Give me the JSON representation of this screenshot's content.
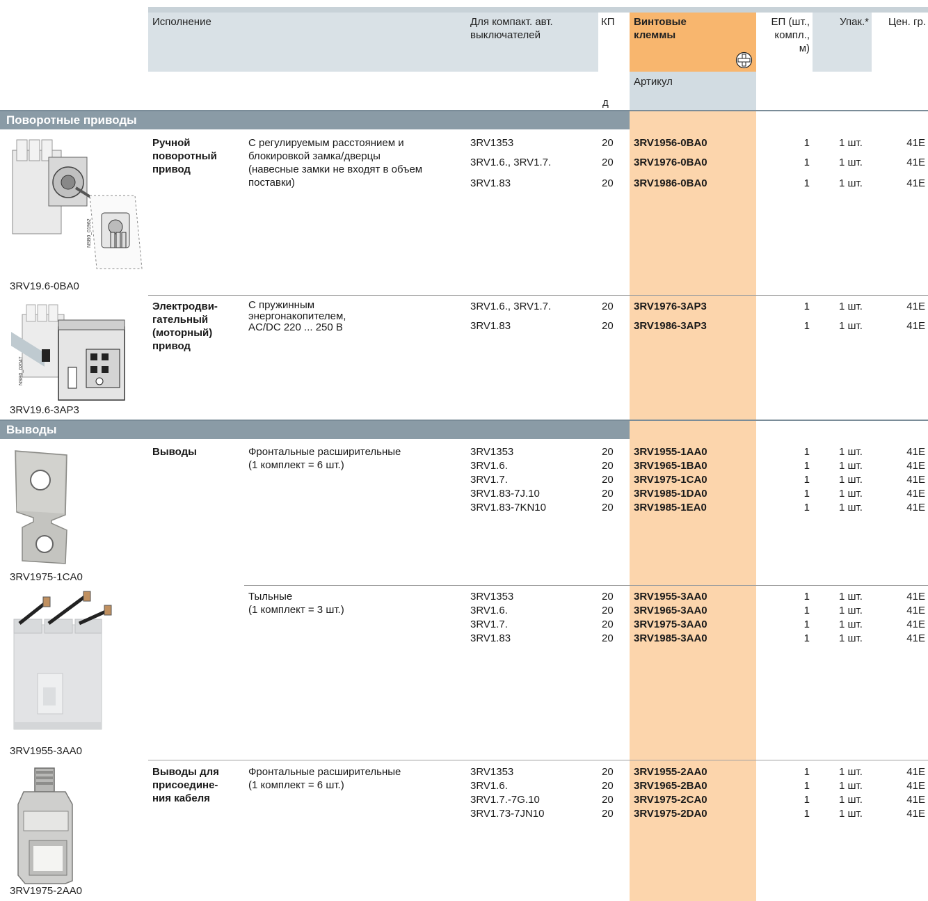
{
  "header": {
    "ispolnenie": "Исполнение",
    "compact_line1": "Для компакт. авт.",
    "compact_line2": "выключателей",
    "kp": "КП",
    "kp_unit": "д",
    "screw_line1": "Винтовые",
    "screw_line2": "клеммы",
    "artikul": "Артикул",
    "ep_line1": "ЕП (шт.,",
    "ep_line2": "компл.,",
    "ep_line3": "м)",
    "upak": "Упак.*",
    "price_group": "Цен. гр."
  },
  "colors": {
    "accent_orange": "#f8b66e",
    "light_orange": "#fcd5ac",
    "header_blue": "#d2dce2",
    "section_bar": "#8a9ba6"
  },
  "sections": [
    {
      "title": "Поворотные приводы",
      "groups": [
        {
          "image_caption": "3RV19.6-0BA0",
          "image_icon": "rotary-handle-drive-icon",
          "name_lines": [
            "Ручной",
            "поворотный",
            "привод"
          ],
          "desc_lines": [
            "С регулируемым расстоянием и",
            "блокировкой замка/дверцы",
            "(навесные замки не входят в объем",
            "поставки)"
          ],
          "rows": [
            {
              "breaker": "3RV1353",
              "kp": "20",
              "article": "3RV1956-0BA0",
              "ep": "1",
              "pack": "1 шт.",
              "price": "41E"
            },
            {
              "breaker": "3RV1.6., 3RV1.7.",
              "kp": "20",
              "article": "3RV1976-0BA0",
              "ep": "1",
              "pack": "1 шт.",
              "price": "41E"
            },
            {
              "breaker": "3RV1.83",
              "kp": "20",
              "article": "3RV1986-0BA0",
              "ep": "1",
              "pack": "1 шт.",
              "price": "41E"
            }
          ]
        },
        {
          "image_caption": "3RV19.6-3AP3",
          "image_icon": "motor-drive-icon",
          "name_lines": [
            "Электродви-",
            "гательный",
            "(моторный)",
            "привод"
          ],
          "desc_lines": [
            "С пружинным",
            "энергонакопителем,",
            "AC/DC 220 ... 250 В"
          ],
          "rows": [
            {
              "breaker": "3RV1.6., 3RV1.7.",
              "kp": "20",
              "article": "3RV1976-3AP3",
              "ep": "1",
              "pack": "1 шт.",
              "price": "41E"
            },
            {
              "breaker": "3RV1.83",
              "kp": "20",
              "article": "3RV1986-3AP3",
              "ep": "1",
              "pack": "1 шт.",
              "price": "41E"
            }
          ]
        }
      ]
    },
    {
      "title": "Выводы",
      "groups": [
        {
          "image_caption": "3RV1975-1CA0",
          "image_icon": "front-terminal-icon",
          "name_lines": [
            "Выводы"
          ],
          "desc_lines": [
            "Фронтальные расширительные",
            "(1 комплект = 6 шт.)"
          ],
          "rows": [
            {
              "breaker": "3RV1353",
              "kp": "20",
              "article": "3RV1955-1AA0",
              "ep": "1",
              "pack": "1 шт.",
              "price": "41E"
            },
            {
              "breaker": "3RV1.6.",
              "kp": "20",
              "article": "3RV1965-1BA0",
              "ep": "1",
              "pack": "1 шт.",
              "price": "41E"
            },
            {
              "breaker": "3RV1.7.",
              "kp": "20",
              "article": "3RV1975-1CA0",
              "ep": "1",
              "pack": "1 шт.",
              "price": "41E"
            },
            {
              "breaker": "3RV1.83-7J.10",
              "kp": "20",
              "article": "3RV1985-1DA0",
              "ep": "1",
              "pack": "1 шт.",
              "price": "41E"
            },
            {
              "breaker": "3RV1.83-7KN10",
              "kp": "20",
              "article": "3RV1985-1EA0",
              "ep": "1",
              "pack": "1 шт.",
              "price": "41E"
            }
          ]
        },
        {
          "image_caption": "3RV1955-3AA0",
          "image_icon": "rear-terminal-icon",
          "name_lines": [],
          "desc_lines": [
            "Тыльные",
            "(1 комплект = 3 шт.)"
          ],
          "rows": [
            {
              "breaker": "3RV1353",
              "kp": "20",
              "article": "3RV1955-3AA0",
              "ep": "1",
              "pack": "1 шт.",
              "price": "41E"
            },
            {
              "breaker": "3RV1.6.",
              "kp": "20",
              "article": "3RV1965-3AA0",
              "ep": "1",
              "pack": "1 шт.",
              "price": "41E"
            },
            {
              "breaker": "3RV1.7.",
              "kp": "20",
              "article": "3RV1975-3AA0",
              "ep": "1",
              "pack": "1 шт.",
              "price": "41E"
            },
            {
              "breaker": "3RV1.83",
              "kp": "20",
              "article": "3RV1985-3AA0",
              "ep": "1",
              "pack": "1 шт.",
              "price": "41E"
            }
          ]
        },
        {
          "image_caption": "3RV1975-2AA0",
          "image_icon": "cable-clamp-terminal-icon",
          "name_lines": [
            "Выводы для",
            "присоедине-",
            "ния кабеля"
          ],
          "desc_lines": [
            "Фронтальные расширительные",
            "(1 комплект = 6 шт.)"
          ],
          "rows": [
            {
              "breaker": "3RV1353",
              "kp": "20",
              "article": "3RV1955-2AA0",
              "ep": "1",
              "pack": "1 шт.",
              "price": "41E"
            },
            {
              "breaker": "3RV1.6.",
              "kp": "20",
              "article": "3RV1965-2BA0",
              "ep": "1",
              "pack": "1 шт.",
              "price": "41E"
            },
            {
              "breaker": "3RV1.7.-7G.10",
              "kp": "20",
              "article": "3RV1975-2CA0",
              "ep": "1",
              "pack": "1 шт.",
              "price": "41E"
            },
            {
              "breaker": "3RV1.73-7JN10",
              "kp": "20",
              "article": "3RV1975-2DA0",
              "ep": "1",
              "pack": "1 шт.",
              "price": "41E"
            }
          ]
        }
      ]
    }
  ],
  "image_labels": {
    "rotary_code": "NSB0_01962",
    "motor_code": "NSB0_02047"
  }
}
